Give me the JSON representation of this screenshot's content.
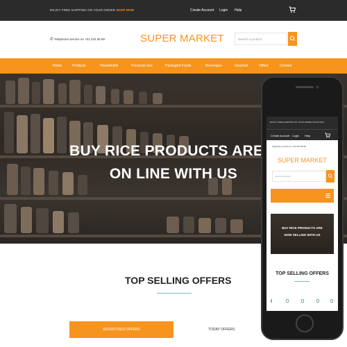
{
  "topbar": {
    "promo_text": "ENJOY FREE SHIPPING ON YOUR ORDER",
    "promo_link": "SHOP NOW",
    "links": [
      "Create Account",
      "Login",
      "Help"
    ],
    "cart_icon": "cart-icon"
  },
  "header": {
    "phone": "Telephone service on +01 234 56 89",
    "logo": "SUPER MARKET",
    "search_placeholder": "Search a product",
    "search_icon": "search-icon"
  },
  "nav": {
    "items": [
      "Home",
      "Products",
      "Households",
      "Personal care",
      "Packaged Foods",
      "Beverages",
      "Gourmet",
      "Offers",
      "Contact"
    ]
  },
  "hero": {
    "line1": "BUY RICE PRODUCTS ARE NOW",
    "line2": "ON LINE WITH US"
  },
  "offers": {
    "title": "TOP SELLING OFFERS",
    "tabs": [
      "ADVERTISED OFFERS",
      "TODAY OFFERS"
    ]
  },
  "mobile": {
    "promo": "ENJOY FREE SHIPPING ON YOUR ORDER  SHOP NOW",
    "links": [
      "Create Account",
      "Login",
      "Help"
    ],
    "phone": "Telephone service on +01 234 56 89",
    "logo": "SUPER MARKET",
    "search_placeholder": "Search a product",
    "hero_line1": "BUY RICE PRODUCTS ARE",
    "hero_line2": "NOW SELLING WITH US",
    "offers_title": "TOP SELLING OFFERS"
  },
  "colors": {
    "accent": "#f7941d",
    "dark": "#2b2b2b"
  }
}
